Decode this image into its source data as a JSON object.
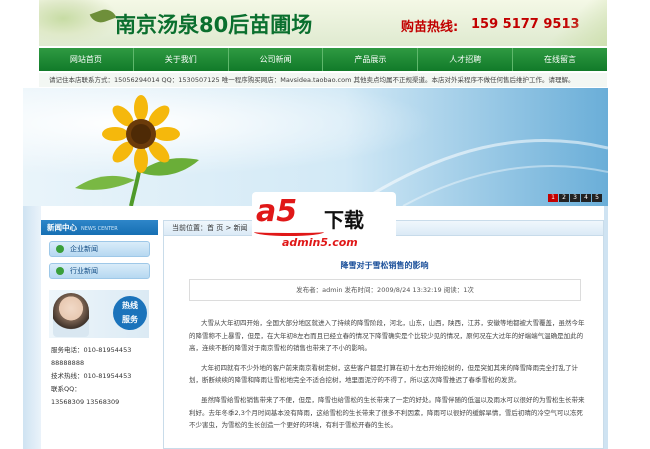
{
  "header": {
    "site_title": "南京汤泉80后苗圃场",
    "hotline_label": "购苗热线:",
    "hotline_number": "159 5177 9513"
  },
  "nav": {
    "items": [
      "网站首页",
      "关于我们",
      "公司新闻",
      "产品展示",
      "人才招聘",
      "在线留言"
    ]
  },
  "notice": {
    "text": "请记住本店联系方式：15056294014 QQ：1530507125 唯一程序购买网店：Mavsidea.taobao.com 其他卖点均属不正规渠道。本店对外采程序不做任何售后维护工作。请理解。"
  },
  "banner": {
    "pager": [
      "1",
      "2",
      "3",
      "4",
      "5"
    ],
    "active_index": 0
  },
  "sidebar": {
    "title": "新闻中心",
    "title_en": "NEWS CENTER",
    "menu": [
      "企业新闻",
      "行业新闻"
    ],
    "service_badge_line1": "热线",
    "service_badge_line2": "服务",
    "contact": [
      "服务电话：010-81954453",
      "88888888",
      "技术热线：010-81954453",
      "联系QQ：",
      "13568309    13568309"
    ]
  },
  "content": {
    "breadcrumb_prefix": "当前位置：",
    "breadcrumb_home": "首 页",
    "breadcrumb_sep": " > ",
    "breadcrumb_section": "新闻",
    "article_title": "降雪对于雪松销售的影响",
    "article_meta": "发布者：admin  发布时间：2009/8/24 13:32:19  阅读：1次",
    "paragraphs": [
      "大雪从大年初四开始，全国大部分地区就进入了持续的降雪阶段，河北，山东，山西，陕西，江苏，安徽等地都被大雪覆盖，虽然今年的降雪称不上暴雪，但是，在大年初8左右而且已经立春的情况下降雪确实是个比较少见的情况，原何况在大过年的好端端气温确是加此的高，连续不断的降雪对于南京雪松的销售也带来了不小的影响。",
      "大年初四就有不少外地的客户前来南京看树定树，这些客户都是打算在初十左右开始挖树的，但是突如其来的降雪降雨完全打乱了计划，断断续续的降雪和降雨让雪松地完全不适合挖树，地里面泥泞的不得了，所以这次降雪推迟了春季雪松的发货。",
      "虽然降雪给雪松销售带来了不便，但是，降雪也给雪松的生长带来了一定的好处。降雪伴随的低温以及雨水可以很好的为雪松生长带来利好。去年冬季2,3个月时间基本没有降雨，这给雪松的生长带来了很多不利因素，降雨可以很好的缓解旱情，雪后初晴的冷空气可以冻死不少害虫，为雪松的生长创造一个更好的环境，有利于雪松开春的生长。"
    ]
  },
  "watermark": {
    "brand": "a5",
    "brand_cn": "下载",
    "url": "admin5.com"
  }
}
